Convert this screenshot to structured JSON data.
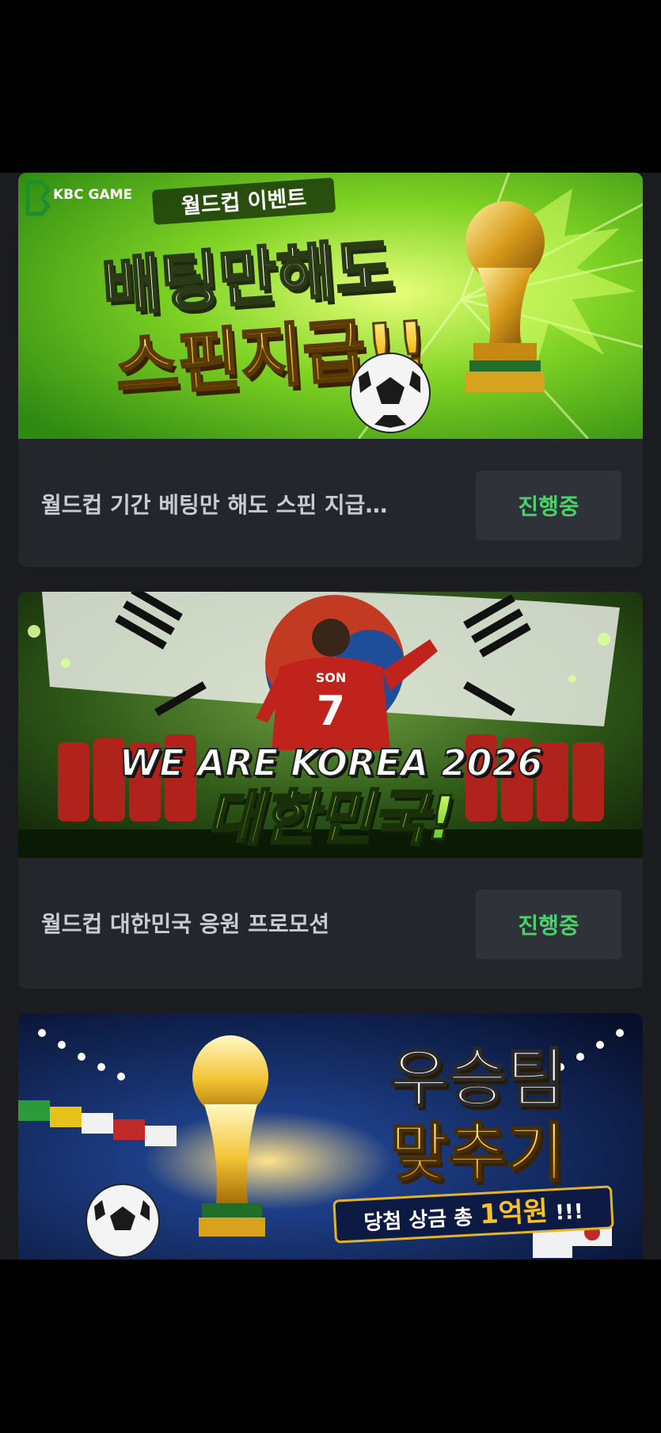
{
  "promotions": [
    {
      "banner": {
        "logo_text": "KBC GAME",
        "subtitle": "월드컵 이벤트",
        "line1": "배팅만해도",
        "line2": "스핀지급!!"
      },
      "title": "월드컵 기간 베팅만 해도 스핀 지급…",
      "status": "진행중"
    },
    {
      "banner": {
        "player_name": "SON",
        "player_number": "7",
        "line1": "WE ARE KOREA 2026",
        "line2": "대한민국!"
      },
      "title": "월드컵 대한민국 응원 프로모션",
      "status": "진행중"
    },
    {
      "banner": {
        "line1": "우승팀",
        "line2": "맞추기",
        "prize_prefix": "당첨 상금 총 ",
        "prize_amount": "1억원",
        "prize_suffix": " !!!"
      }
    }
  ],
  "colors": {
    "background": "#000000",
    "panel": "#1b1c20",
    "card": "#24262c",
    "status_bg": "#30323a",
    "status_text": "#49d26a",
    "title_text": "#c9cbd1"
  }
}
